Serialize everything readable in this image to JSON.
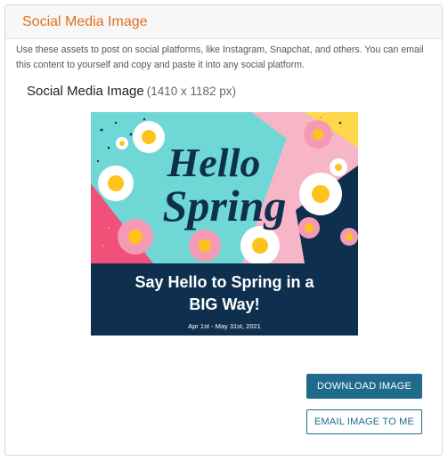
{
  "panel": {
    "title": "Social Media Image",
    "description": "Use these assets to post on social platforms, like Instagram, Snapchat, and others. You can email this content to yourself and copy and paste it into any social platform."
  },
  "asset": {
    "title": "Social Media Image",
    "dimensions": "(1410 x 1182 px)"
  },
  "image": {
    "headline_line1": "Hello",
    "headline_line2": "Spring",
    "banner_line1": "Say Hello to Spring in a",
    "banner_line2": "BIG Way!",
    "date_range": "Apr 1st - May 31st, 2021",
    "colors": {
      "navy": "#0f2f4f",
      "teal": "#6fd8d6",
      "pink": "#f7b6c8",
      "hot_pink": "#f0507a",
      "yellow": "#ffd84a"
    }
  },
  "buttons": {
    "download": "DOWNLOAD IMAGE",
    "email": "EMAIL IMAGE TO ME"
  }
}
